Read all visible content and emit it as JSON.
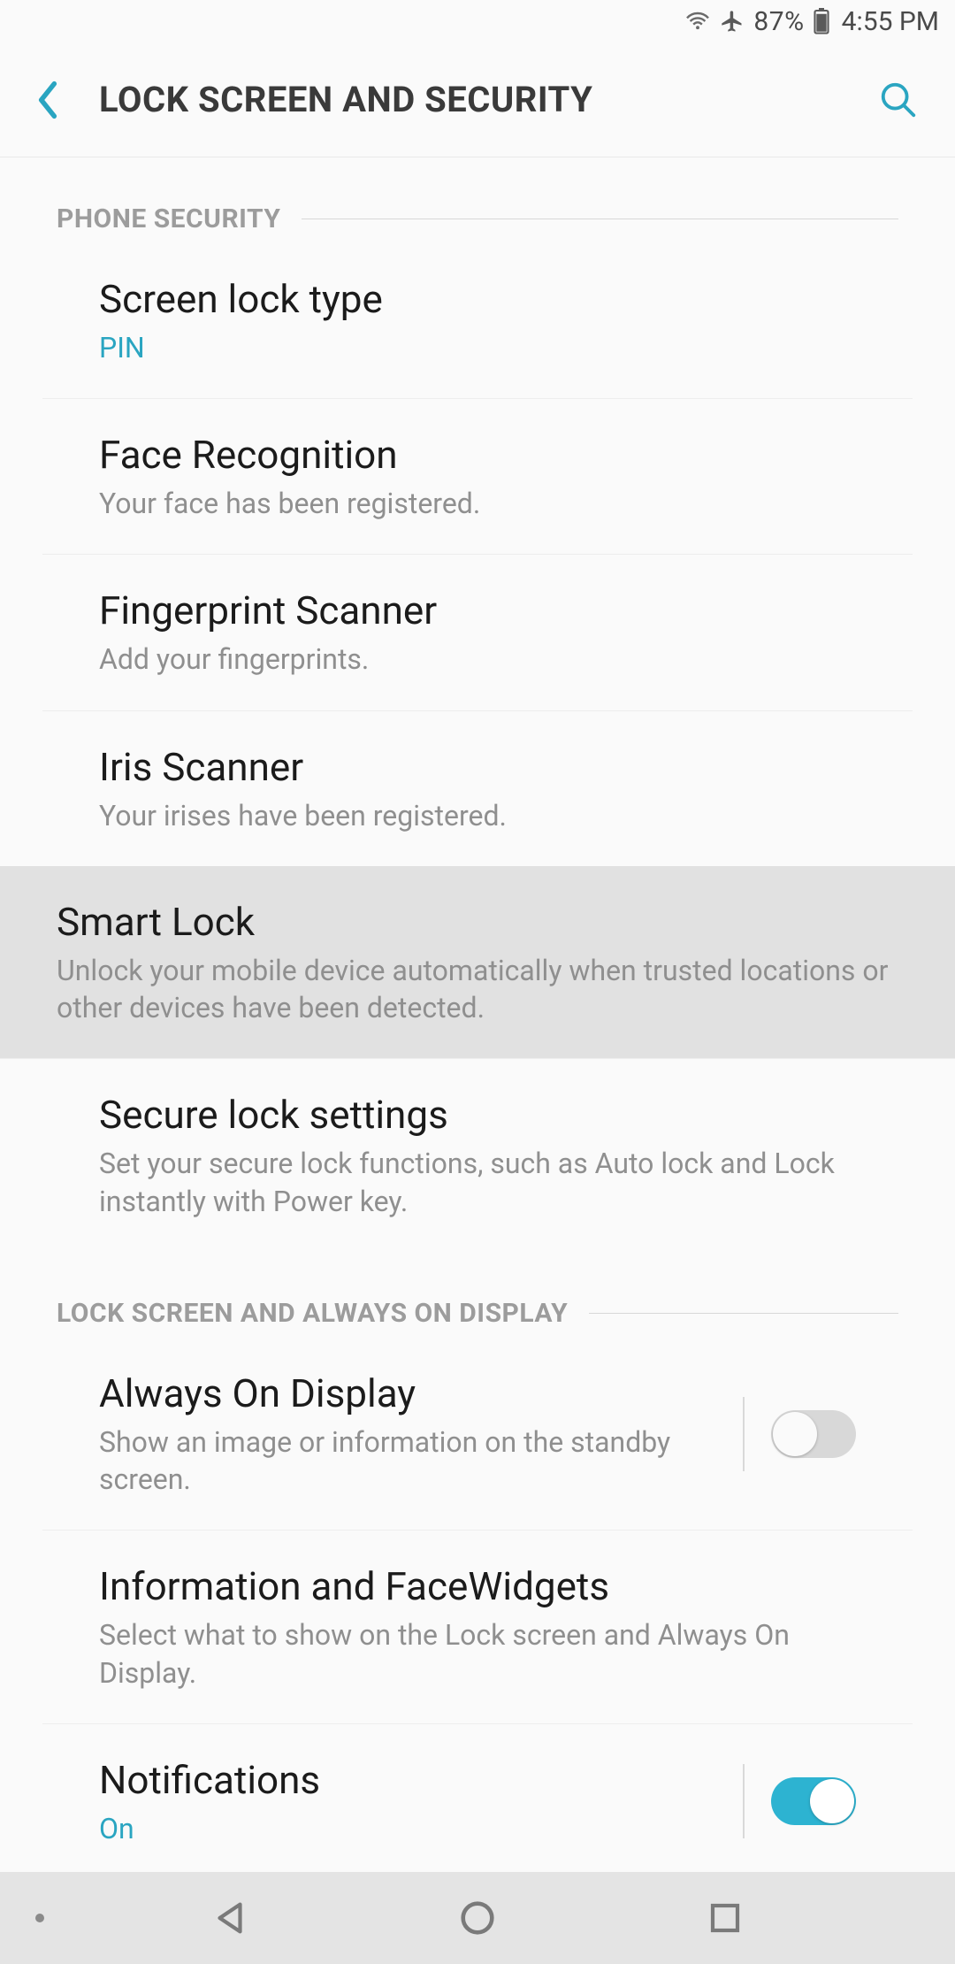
{
  "status": {
    "battery_pct": "87%",
    "time": "4:55 PM"
  },
  "header": {
    "title": "LOCK SCREEN AND SECURITY"
  },
  "sections": {
    "phone_security": {
      "label": "PHONE SECURITY",
      "items": {
        "screen_lock_type": {
          "title": "Screen lock type",
          "sub": "PIN"
        },
        "face_recognition": {
          "title": "Face Recognition",
          "sub": "Your face has been registered."
        },
        "fingerprint_scanner": {
          "title": "Fingerprint Scanner",
          "sub": "Add your fingerprints."
        },
        "iris_scanner": {
          "title": "Iris Scanner",
          "sub": "Your irises have been registered."
        },
        "smart_lock": {
          "title": "Smart Lock",
          "sub": "Unlock your mobile device automatically when trusted locations or other devices have been detected."
        },
        "secure_lock_settings": {
          "title": "Secure lock settings",
          "sub": "Set your secure lock functions, such as Auto lock and Lock instantly with Power key."
        }
      }
    },
    "lock_screen_aod": {
      "label": "LOCK SCREEN AND ALWAYS ON DISPLAY",
      "items": {
        "always_on_display": {
          "title": "Always On Display",
          "sub": "Show an image or information on the standby screen.",
          "toggle": false
        },
        "info_facewidgets": {
          "title": "Information and FaceWidgets",
          "sub": "Select what to show on the Lock screen and Always On Display."
        },
        "notifications": {
          "title": "Notifications",
          "sub": "On",
          "toggle": true
        }
      }
    }
  },
  "colors": {
    "accent": "#2aa5c1",
    "toggle_on": "#2db3d1"
  }
}
